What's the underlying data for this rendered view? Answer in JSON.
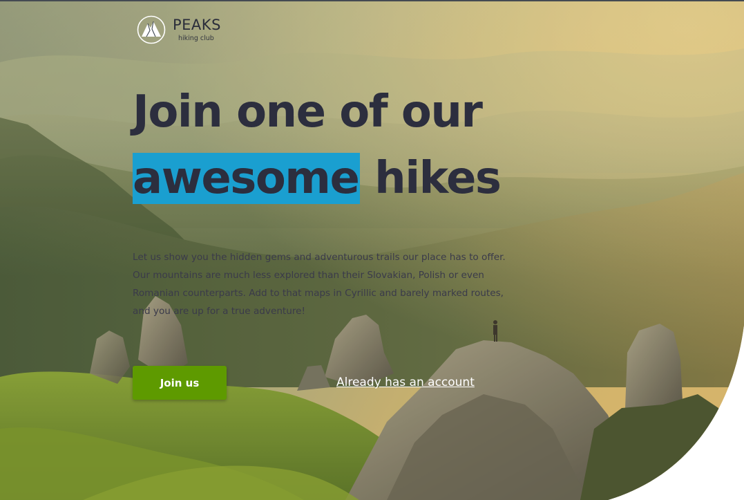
{
  "brand": {
    "name": "PEAKS",
    "tagline": "hiking club"
  },
  "hero": {
    "headline_line1": "Join one of our",
    "headline_highlight": "awesome",
    "headline_rest": " hikes",
    "intro": "Let us show you the hidden gems and adventurous trails our place has to offer. Our mountains are much less explored than their Slovakian, Polish or even Romanian counterparts. Add to that maps in Cyrillic and barely marked routes, and you are up for a true adventure!",
    "join_label": "Join us",
    "account_link_label": "Already has an account"
  },
  "colors": {
    "headline": "#2c2e3e",
    "highlight": "#1a9fd0",
    "join_button": "#5e9a00",
    "link": "#ffffff"
  },
  "icons": {
    "logo": "mountain-peak-logo-icon"
  }
}
